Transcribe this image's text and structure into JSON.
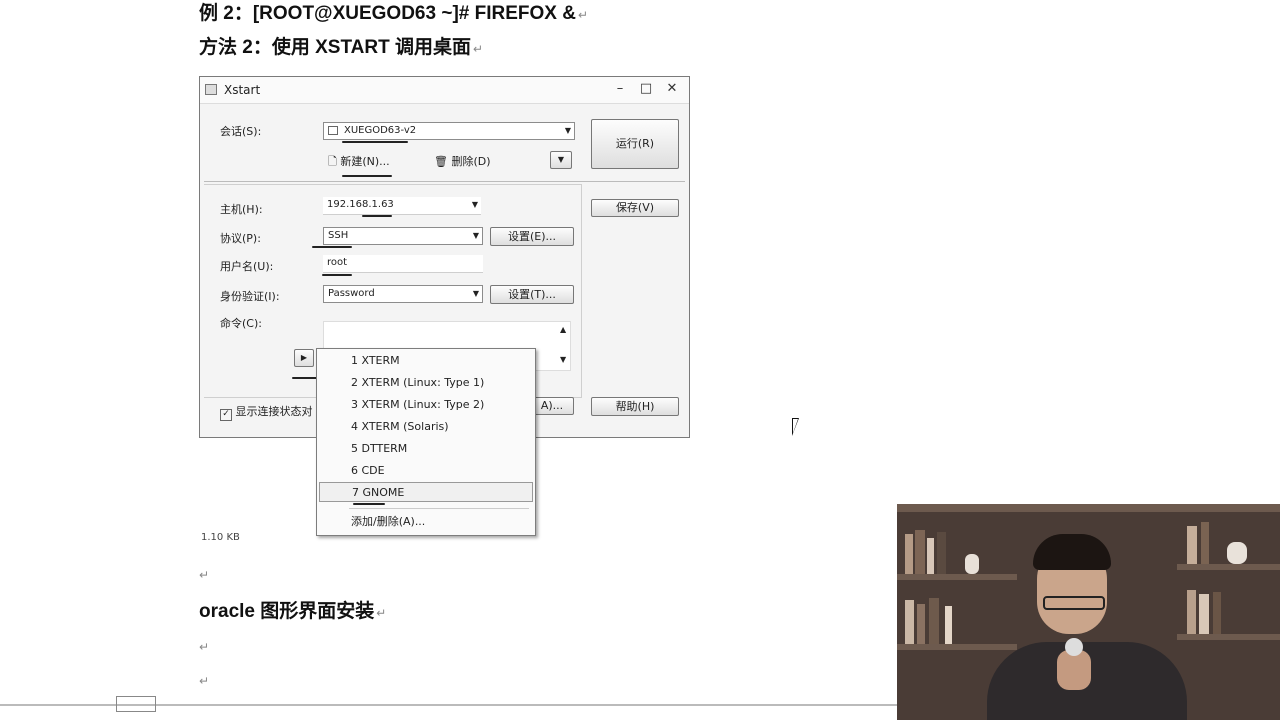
{
  "document": {
    "line1": "例 2：[ROOT@XUEGOD63  ~]# FIREFOX &",
    "line2": "方法 2：使用 XSTART 调用桌面",
    "heading": "oracle  图形界面安装",
    "return_mark": "↵",
    "image_size_caption": "1.10 KB"
  },
  "xstart": {
    "title": "Xstart",
    "window_controls": {
      "minimize": "–",
      "maximize": "□",
      "close": "✕"
    },
    "session_label": "会话(S):",
    "session_value": "XUEGOD63-v2",
    "new_label": "新建(N)...",
    "delete_label": "删除(D)",
    "run_button": "运行(R)",
    "host_label": "主机(H):",
    "host_value": "192.168.1.63",
    "save_button": "保存(V)",
    "protocol_label": "协议(P):",
    "protocol_value": "SSH",
    "protocol_settings": "设置(E)...",
    "user_label": "用户名(U):",
    "user_value": "root",
    "auth_label": "身份验证(I):",
    "auth_value": "Password",
    "auth_settings": "设置(T)...",
    "command_label": "命令(C):",
    "show_status_label": "显示连接状态对",
    "help_button": "帮助(H)",
    "hidden_button_fragment": "A)..."
  },
  "command_menu": {
    "items": [
      "1 XTERM",
      "2 XTERM (Linux: Type 1)",
      "3 XTERM (Linux: Type 2)",
      "4 XTERM (Solaris)",
      "5 DTTERM",
      "6 CDE",
      "7 GNOME"
    ],
    "selected": "7 GNOME",
    "add_remove": "添加/删除(A)..."
  }
}
